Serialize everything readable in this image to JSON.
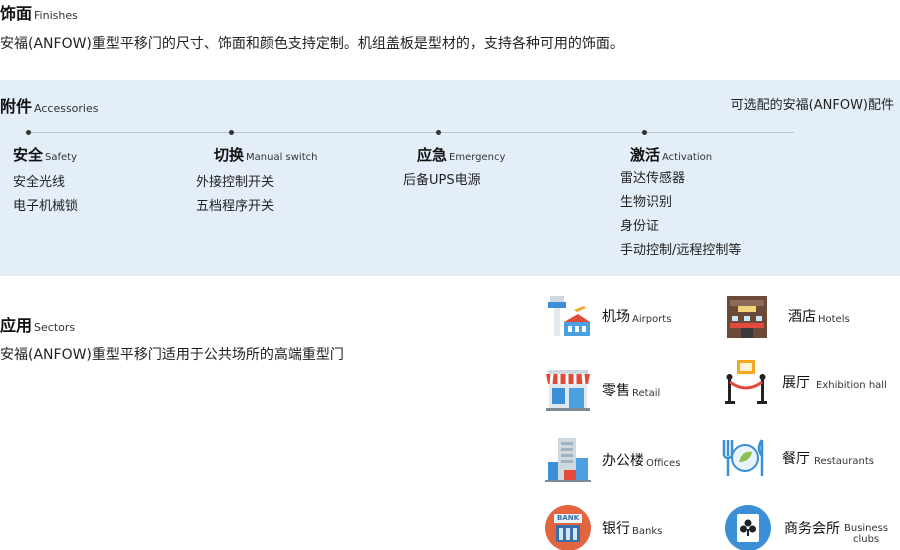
{
  "finishes": {
    "title_zh": "饰面",
    "title_en": "Finishes",
    "description": "安福(ANFOW)重型平移门的尺寸、饰面和颜色支持定制。机组盖板是型材的，支持各种可用的饰面。"
  },
  "accessories": {
    "title_zh": "附件",
    "title_en": "Accessories",
    "optional_note": "可选配的安福(ANFOW)配件",
    "categories": [
      {
        "title_zh": "安全",
        "title_en": "Safety",
        "items": [
          "安全光线",
          "电子机械锁"
        ]
      },
      {
        "title_zh": "切换",
        "title_en": "Manual switch",
        "items": [
          "外接控制开关",
          "五档程序开关"
        ]
      },
      {
        "title_zh": "应急",
        "title_en": "Emergency",
        "items": [
          "后备UPS电源"
        ]
      },
      {
        "title_zh": "激活",
        "title_en": "Activation",
        "items": [
          "雷达传感器",
          "生物识别",
          "身份证",
          "手动控制/远程控制等"
        ]
      }
    ]
  },
  "sectors": {
    "title_zh": "应用",
    "title_en": "Sectors",
    "description": "安福(ANFOW)重型平移门适用于公共场所的高端重型门",
    "items": [
      {
        "icon": "airport-icon",
        "zh": "机场",
        "en": "Airports"
      },
      {
        "icon": "hotel-icon",
        "zh": "酒店",
        "en": "Hotels"
      },
      {
        "icon": "retail-icon",
        "zh": "零售",
        "en": "Retail"
      },
      {
        "icon": "exhibition-icon",
        "zh": "展厅",
        "en": "Exhibition hall"
      },
      {
        "icon": "office-icon",
        "zh": "办公楼",
        "en": "Offices"
      },
      {
        "icon": "restaurant-icon",
        "zh": "餐厅",
        "en": "Restaurants"
      },
      {
        "icon": "bank-icon",
        "zh": "银行",
        "en": "Banks",
        "badge": "BANK"
      },
      {
        "icon": "business-club-icon",
        "zh": "商务会所",
        "en_line1": "Business",
        "en_line2": "clubs"
      }
    ]
  },
  "colors": {
    "band": "#e4eef8",
    "accent_blue": "#3a8fd6",
    "accent_red": "#e24a3b",
    "accent_orange": "#f5a623"
  }
}
